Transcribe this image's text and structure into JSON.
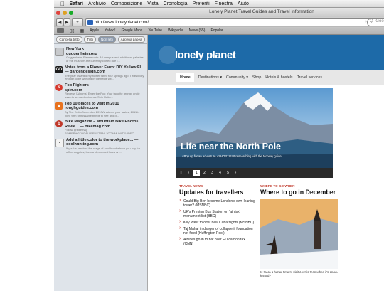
{
  "menubar": {
    "apple": "",
    "items": [
      "Safari",
      "Archivio",
      "Composizione",
      "Vista",
      "Cronologia",
      "Preferiti",
      "Finestra",
      "Aiuto"
    ]
  },
  "window": {
    "title": "Lonely Planet Travel Guides and Travel Information",
    "url": "http://www.lonelyplanet.com/",
    "search_placeholder": "Q- Goo"
  },
  "bookmarks": [
    "Apple",
    "Yahoo!",
    "Google Maps",
    "YouTube",
    "Wikipedia",
    "News (55)",
    "Popular"
  ],
  "sidebar": {
    "tabs": [
      "Cancella tutto",
      "Tutti",
      "Non letti",
      "Appena papea"
    ],
    "items": [
      {
        "title": "New York",
        "site": "guggenheim.org",
        "desc": "Guggenheim Please note: All campus and additional galleries of the museum are currently closed due t..."
      },
      {
        "title": "Notes from a Flower Farm: DIY Yellow Fl... — gardendesign.com",
        "site": "",
        "desc": "The year I started my flower farm, four springs ago, I was lucky enough to be working in the fields wit..."
      },
      {
        "title": "Foo Fighters",
        "site": "spin.com",
        "desc": "Reviews [Albums] Enter the Foo: Your favorite grungy uncle asserts arena dominance Spin Ratin..."
      },
      {
        "title": "Top 10 places to visit in 2011",
        "site": "roughguides.com",
        "desc": "By The EditorDecember 2010Whatever your tastes, 2011 is filled with unmissable things to see and d..."
      },
      {
        "title": "Bike Magazine – Mountain Bike Photos, Revie... — bikemag.com",
        "site": "",
        "desc": "Follow @bikemag SOMEPHOTOGALLERYSTRAIL2COMMUNITYVIDEO..."
      },
      {
        "title": "Add a little color to the workplace... — coolhunting.com",
        "site": "",
        "desc": "If you've reached the stage of adulthood where you pay for office supplies, the candy-colored hues an..."
      }
    ]
  },
  "lp": {
    "logo": "lonely planet",
    "nav": [
      "Home",
      "Destinations ▾",
      "Community ▾",
      "Shop",
      "Hotels & hostels",
      "Travel services"
    ],
    "hero_title": "Life near the North Pole",
    "hero_sub": "› Pop up for an adventure   › SHOP: Start researching with the Norway guide",
    "pager": [
      "‖",
      "‹",
      "1",
      "2",
      "3",
      "4",
      "5",
      "›"
    ],
    "left_kicker": "TRAVEL NEWS",
    "left_heading": "Updates for travellers",
    "news": [
      "Could Big Ben become London's own leaning tower? (MSNBC)",
      "UK's Preston Bus Station on 'at risk' monument list (BBC)",
      "Key West to offer new Cuba flights (MSNBC)",
      "Taj Mahal in danger of collapse if foundation not fixed (Huffington Post)",
      "Airlines go in to bat over EU carbon tax (CNN)"
    ],
    "right_kicker": "WHERE TO GO WHEN",
    "right_heading": "Where to go in December",
    "caption": "Is there a better time to visit Austria than when it's snow-kissed?"
  }
}
